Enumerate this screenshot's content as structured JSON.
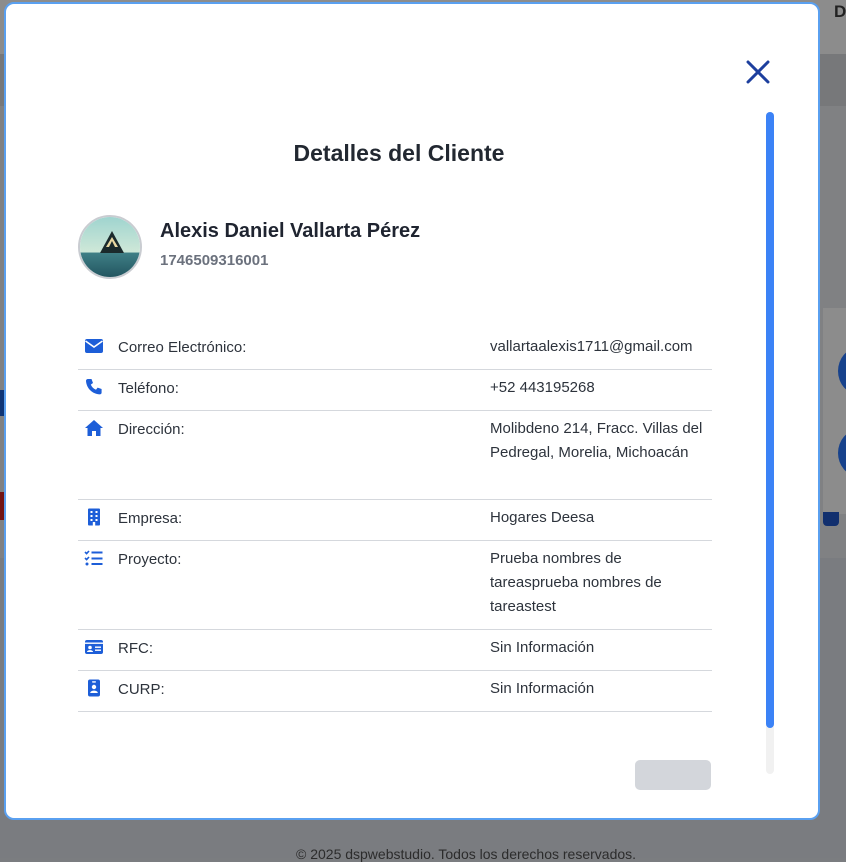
{
  "background": {
    "top_letter": "D",
    "footer_text": "© 2025 dspwebstudio. Todos los derechos reservados."
  },
  "modal": {
    "title": "Detalles del Cliente",
    "close_icon": "close-icon",
    "client": {
      "name": "Alexis Daniel Vallarta Pérez",
      "id": "1746509316001"
    },
    "details": [
      {
        "icon": "envelope-icon",
        "label": "Correo Electrónico:",
        "value": "vallartaalexis1711@gmail.com"
      },
      {
        "icon": "phone-icon",
        "label": "Teléfono:",
        "value": "+52 443195268"
      },
      {
        "icon": "home-icon",
        "label": "Dirección:",
        "value": "Molibdeno 214, Fracc. Villas del Pedregal, Morelia, Michoacán"
      },
      {
        "icon": "building-icon",
        "label": "Empresa:",
        "value": "Hogares Deesa"
      },
      {
        "icon": "list-check-icon",
        "label": "Proyecto:",
        "value": "Prueba nombres de tareasprueba nombres de tareastest"
      },
      {
        "icon": "id-card-icon",
        "label": "RFC:",
        "value": "Sin Información"
      },
      {
        "icon": "id-badge-icon",
        "label": "CURP:",
        "value": "Sin Información"
      }
    ],
    "accent_color": "#1d5ed8",
    "scroll_color": "#3b82f6"
  }
}
